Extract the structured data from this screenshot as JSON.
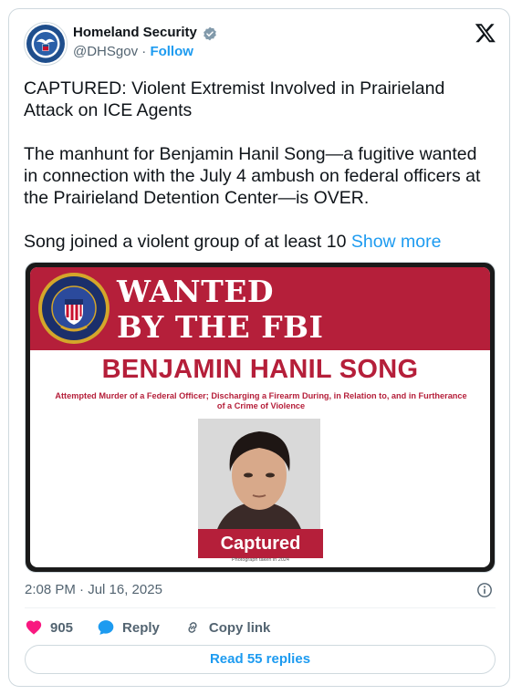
{
  "author": {
    "name": "Homeland Security",
    "handle": "@DHSgov",
    "separator": " · ",
    "follow_label": "Follow"
  },
  "tweet": {
    "line1": "CAPTURED: Violent Extremist Involved in Prairieland",
    "line2": "Attack on ICE Agents",
    "para2_line1": "The manhunt for Benjamin Hanil Song—a fugitive wanted",
    "para2_line2": "in connection with the July 4 ambush on federal officers at",
    "para2_line3": "the Prairieland Detention Center—is OVER.",
    "para3": "Song joined a violent group of at least 10 ",
    "show_more": "Show more"
  },
  "poster": {
    "wanted_1": "WANTED",
    "wanted_2": "BY THE FBI",
    "name": "BENJAMIN HANIL SONG",
    "charges_line1": "Attempted Murder of a Federal Officer; Discharging a Firearm During, in Relation to, and in Furtherance",
    "charges_line2": "of a Crime of Violence",
    "status": "Captured",
    "photo_note": "Photograph taken in 2024",
    "seal_text": "DEPARTMENT OF JUSTICE · FEDERAL BUREAU OF INVESTIGATION"
  },
  "meta": {
    "timestamp": "2:08 PM · Jul 16, 2025"
  },
  "actions": {
    "likes": "905",
    "reply_label": "Reply",
    "copy_link_label": "Copy link",
    "read_replies": "Read 55 replies"
  },
  "colors": {
    "accent": "#1d9bf0",
    "like": "#f91880",
    "poster_red": "#b51f3a",
    "muted": "#536471"
  },
  "icons": [
    "dhs-seal-avatar",
    "verified-badge-icon",
    "x-logo-icon",
    "fbi-seal-icon",
    "info-icon",
    "heart-icon",
    "reply-bubble-icon",
    "link-icon"
  ]
}
